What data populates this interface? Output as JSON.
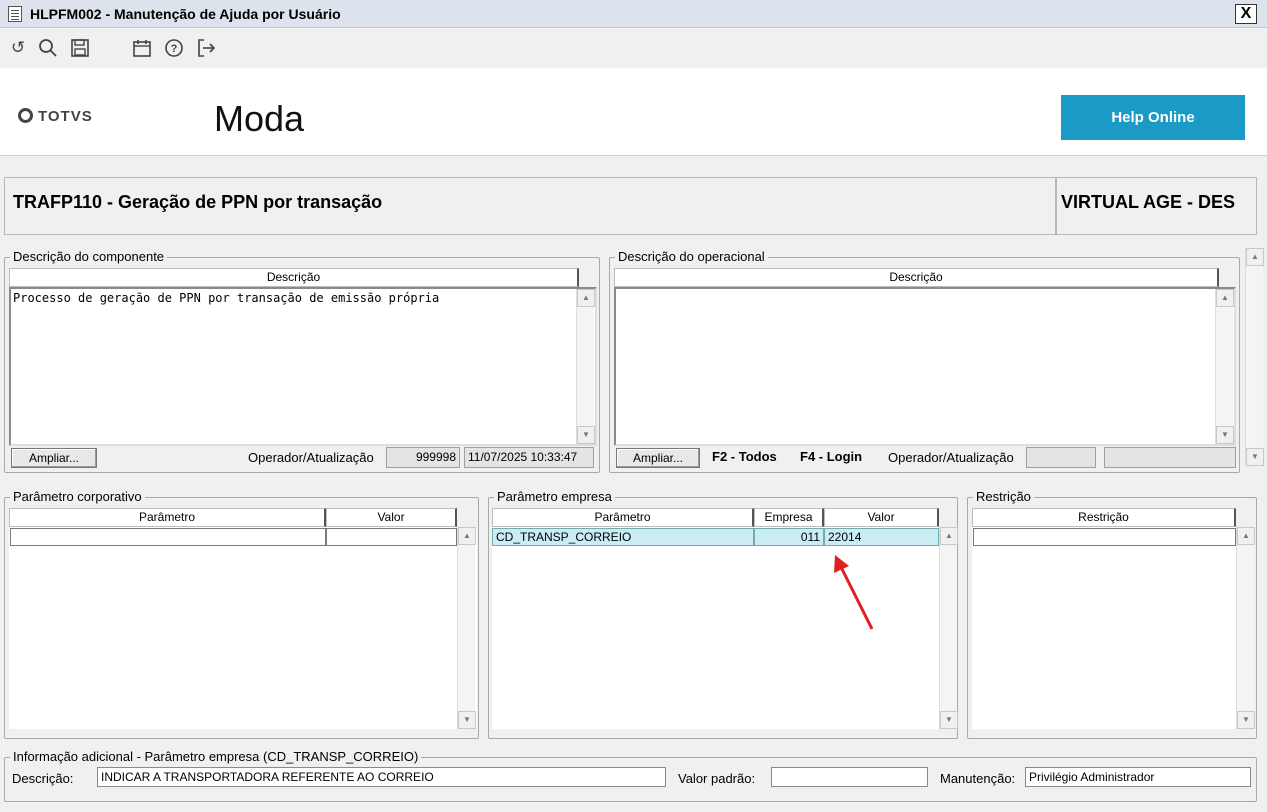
{
  "window": {
    "title": "HLPFM002 - Manutenção de Ajuda por Usuário",
    "close_label": "X"
  },
  "toolbar": {
    "icons": [
      "undo-icon",
      "search-icon",
      "save-icon",
      "calendar-icon",
      "help-icon",
      "exit-icon"
    ]
  },
  "header": {
    "logo_text": "TOTVS",
    "module": "Moda",
    "help_button": "Help Online"
  },
  "program": {
    "title": "TRAFP110 - Geração de PPN por transação",
    "system": "VIRTUAL AGE - DES"
  },
  "componente": {
    "legend": "Descrição do componente",
    "col_header": "Descrição",
    "text": "Processo de geração de PPN por transação de emissão própria",
    "ampliar": "Ampliar...",
    "operador_label": "Operador/Atualização",
    "operador": "999998",
    "atualizacao": "11/07/2025 10:33:47"
  },
  "operacional": {
    "legend": "Descrição do operacional",
    "col_header": "Descrição",
    "text": "",
    "ampliar": "Ampliar...",
    "f2": "F2 - Todos",
    "f4": "F4 - Login",
    "operador_label": "Operador/Atualização",
    "operador": "",
    "atualizacao": ""
  },
  "corporativo": {
    "legend": "Parâmetro corporativo",
    "columns": [
      "Parâmetro",
      "Valor"
    ],
    "rows": [
      {
        "parametro": "",
        "valor": ""
      }
    ]
  },
  "empresa": {
    "legend": "Parâmetro empresa",
    "columns": [
      "Parâmetro",
      "Empresa",
      "Valor"
    ],
    "rows": [
      {
        "parametro": "CD_TRANSP_CORREIO",
        "empresa": "011",
        "valor": "22014"
      }
    ]
  },
  "restricao": {
    "legend": "Restrição",
    "columns": [
      "Restrição"
    ],
    "rows": [
      {
        "restricao": ""
      }
    ]
  },
  "info": {
    "legend": "Informação adicional - Parâmetro empresa (CD_TRANSP_CORREIO)",
    "descricao_label": "Descrição:",
    "descricao": "INDICAR A TRANSPORTADORA REFERENTE AO CORREIO",
    "valor_padrao_label": "Valor padrão:",
    "valor_padrao": "",
    "manutencao_label": "Manutenção:",
    "manutencao": "Privilégio Administrador"
  },
  "annotation": {
    "color": "#e0201c"
  }
}
